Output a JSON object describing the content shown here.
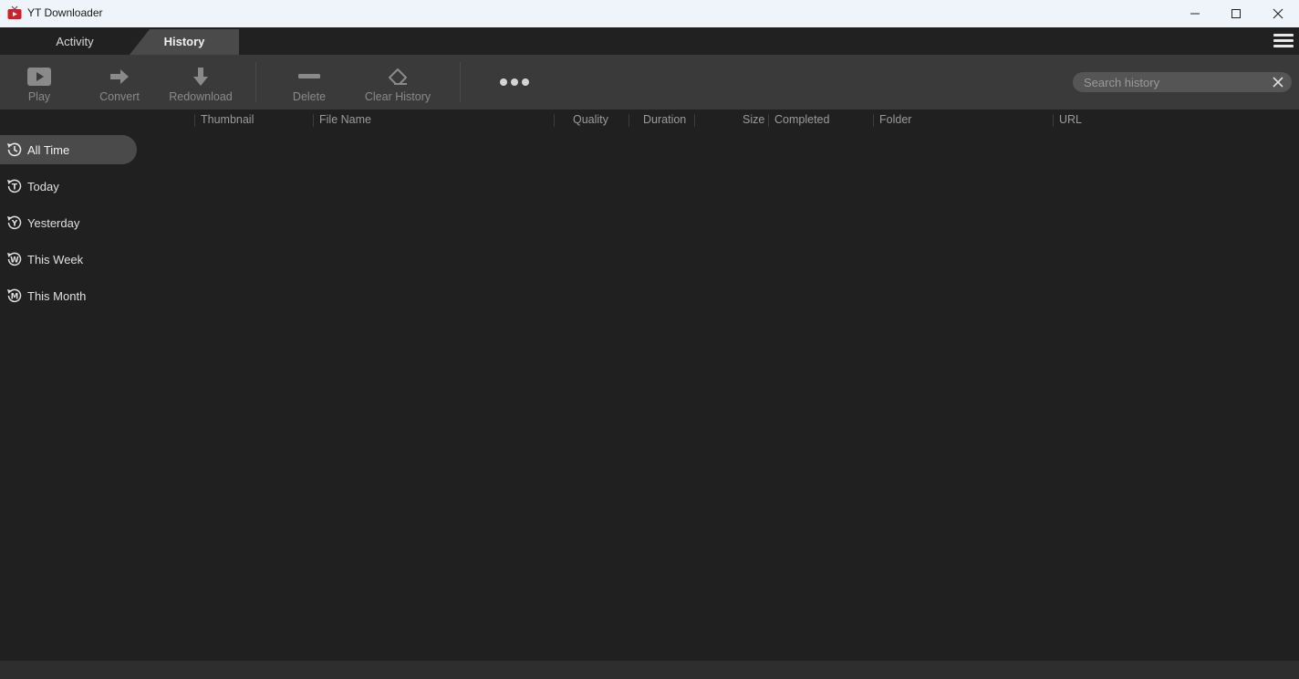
{
  "window": {
    "title": "YT Downloader",
    "icons": {
      "app": "tv-app-icon",
      "minimize": "minimize-icon",
      "maximize": "maximize-icon",
      "close": "close-icon"
    }
  },
  "tabs": [
    {
      "label": "Activity",
      "active": false
    },
    {
      "label": "History",
      "active": true
    }
  ],
  "toolbar": {
    "play": "Play",
    "convert": "Convert",
    "redownload": "Redownload",
    "delete": "Delete",
    "clear_history": "Clear History"
  },
  "search": {
    "placeholder": "Search history",
    "value": ""
  },
  "columns": {
    "thumbnail": "Thumbnail",
    "file_name": "File Name",
    "quality": "Quality",
    "duration": "Duration",
    "size": "Size",
    "completed": "Completed",
    "folder": "Folder",
    "url": "URL"
  },
  "sidebar": {
    "items": [
      {
        "label": "All Time",
        "icon": "clock-history-icon",
        "active": true
      },
      {
        "label": "Today",
        "icon": "t-circle-icon",
        "active": false
      },
      {
        "label": "Yesterday",
        "icon": "y-circle-icon",
        "active": false
      },
      {
        "label": "This Week",
        "icon": "w-circle-icon",
        "active": false
      },
      {
        "label": "This Month",
        "icon": "m-circle-icon",
        "active": false
      }
    ]
  },
  "colors": {
    "background": "#202020",
    "toolbar": "#3a3a3a",
    "active_tab": "#4a4a4a",
    "titlebar": "#eef4f9",
    "app_icon_red": "#d0202a"
  }
}
